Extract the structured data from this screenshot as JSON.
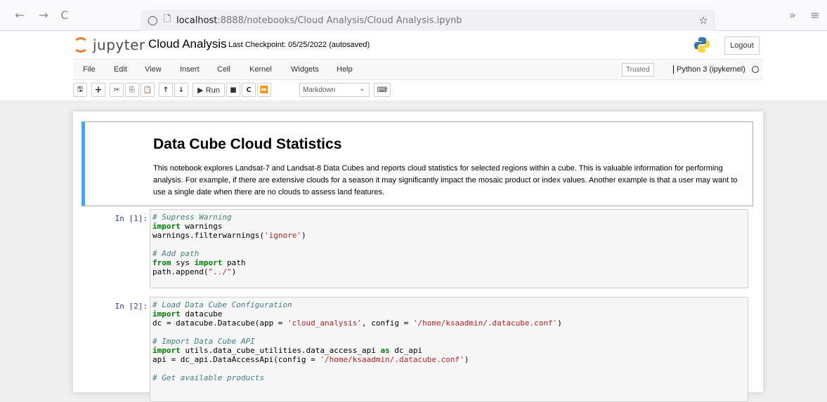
{
  "browser": {
    "back": "←",
    "forward": "→",
    "reload": "C",
    "url_host": "localhost",
    "url_rest": ":8888/notebooks/Cloud Analysis/Cloud Analysis.ipynb",
    "star": "☆",
    "extensions": "»",
    "menu": "≡"
  },
  "jupyter": {
    "logo_text": "jupyter",
    "notebook_title": "Cloud Analysis",
    "checkpoint": "Last Checkpoint: 05/25/2022  (autosaved)",
    "logout": "Logout",
    "menu": [
      "File",
      "Edit",
      "View",
      "Insert",
      "Cell",
      "Kernel",
      "Widgets",
      "Help"
    ],
    "trusted": "Trusted",
    "kernel": "Python 3 (ipykernel)",
    "toolbar": {
      "save": "🖫",
      "add": "+",
      "cut": "✂",
      "copy": "⎘",
      "paste": "📋",
      "up": "↑",
      "down": "↓",
      "run": "▶ Run",
      "stop": "■",
      "restart": "C",
      "fastforward": "⏩",
      "cell_type": "Markdown",
      "command_palette": "⌨"
    }
  },
  "cells": {
    "markdown": {
      "heading": "Data Cube Cloud Statistics",
      "paragraph": "This notebook explores Landsat-7 and Landsat-8 Data Cubes and reports cloud statistics for selected regions within a cube. This is valuable information for performing analysis. For example, if there are extensive clouds for a season it may significantly impact the mosaic product or index values. Another example is that a user may want to use a single date when there are no clouds to assess land features."
    },
    "code1": {
      "prompt": "In [1]:",
      "c1": "# Supress Warning",
      "kw1": "import",
      "t1": " warnings",
      "t2a": "warnings.filterwarnings(",
      "s1": "'ignore'",
      "t2b": ")",
      "c2": "# Add path",
      "kw2": "from",
      "t3a": " sys ",
      "kw3": "import",
      "t3b": " path",
      "t4a": "path.append(",
      "s2": "\"../\"",
      "t4b": ")"
    },
    "code2": {
      "prompt": "In [2]:",
      "c1": "# Load Data Cube Configuration",
      "kw1": "import",
      "t1": " datacube",
      "t2a": "dc = datacube.Datacube(app = ",
      "s1": "'cloud_analysis'",
      "t2b": ", config = ",
      "s2": "'/home/ksaadmin/.datacube.conf'",
      "t2c": ")",
      "c2": "# Import Data Cube API",
      "kw2": "import",
      "t3a": " utils.data_cube_utilities.data_access_api ",
      "kw3": "as",
      "t3b": " dc_api",
      "t4a": "api = dc_api.DataAccessApi(config = ",
      "s3": "'/home/ksaadmin/.datacube.conf'",
      "t4b": ")",
      "c3": "# Get available products"
    }
  },
  "colors": {
    "accent_orange": "#f37726",
    "markdown_border": "#42a5f5",
    "prompt": "#303f9f"
  }
}
